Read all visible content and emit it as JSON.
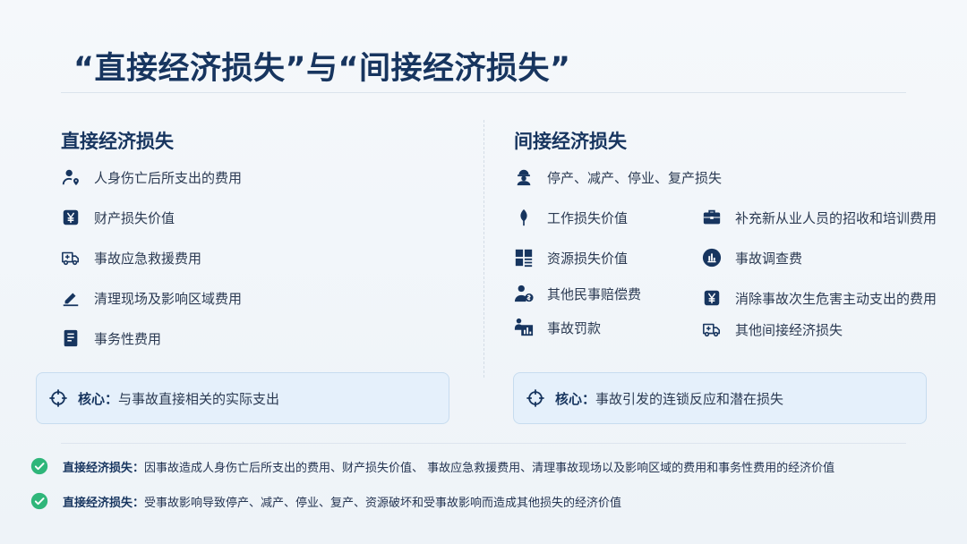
{
  "title": "“直接经济损失”与“间接经济损失”",
  "direct": {
    "heading": "直接经济损失",
    "items": [
      {
        "icon": "person-location-icon",
        "label": "人身伤亡后所支出的费用"
      },
      {
        "icon": "yen-icon",
        "label": "财产损失价值"
      },
      {
        "icon": "ambulance-icon",
        "label": "事故应急救援费用"
      },
      {
        "icon": "eraser-icon",
        "label": "清理现场及影响区域费用"
      },
      {
        "icon": "document-icon",
        "label": "事务性费用"
      }
    ],
    "core_label": "核心：",
    "core_text": "与事故直接相关的实际支出"
  },
  "indirect": {
    "heading": "间接经济损失",
    "items": [
      {
        "icon": "worker-icon",
        "label": "停产、减产、停业、复产损失"
      },
      {
        "icon": "leaf-icon",
        "label": "工作损失价值"
      },
      {
        "icon": "briefcase-icon",
        "label": "补充新从业人员的招收和培训费用"
      },
      {
        "icon": "grid-icon",
        "label": "资源损失价值"
      },
      {
        "icon": "chart-circle-icon",
        "label": "事故调查费"
      },
      {
        "icon": "person-money-icon",
        "label": "其他民事赔偿费"
      },
      {
        "icon": "yen-icon",
        "label": "消除事故次生危害主动支出的费用"
      },
      {
        "icon": "person-chart-icon",
        "label": "事故罚款"
      },
      {
        "icon": "ambulance-icon",
        "label": "其他间接经济损失"
      }
    ],
    "core_label": "核心：",
    "core_text": "事故引发的连锁反应和潜在损失"
  },
  "notes": [
    {
      "label": "直接经济损失：",
      "text": "因事故造成人身伤亡后所支出的费用、财产损失价值、 事故应急救援费用、清理事故现场以及影响区域的费用和事务性费用的经济价值"
    },
    {
      "label": "直接经济损失：",
      "text": "受事故影响导致停产、减产、停业、复产、资源破坏和受事故影响而造成其他损失的经济价值"
    }
  ],
  "colors": {
    "primary": "#17355f",
    "check": "#2fb67a",
    "core_bg": "#e5f0fb"
  }
}
